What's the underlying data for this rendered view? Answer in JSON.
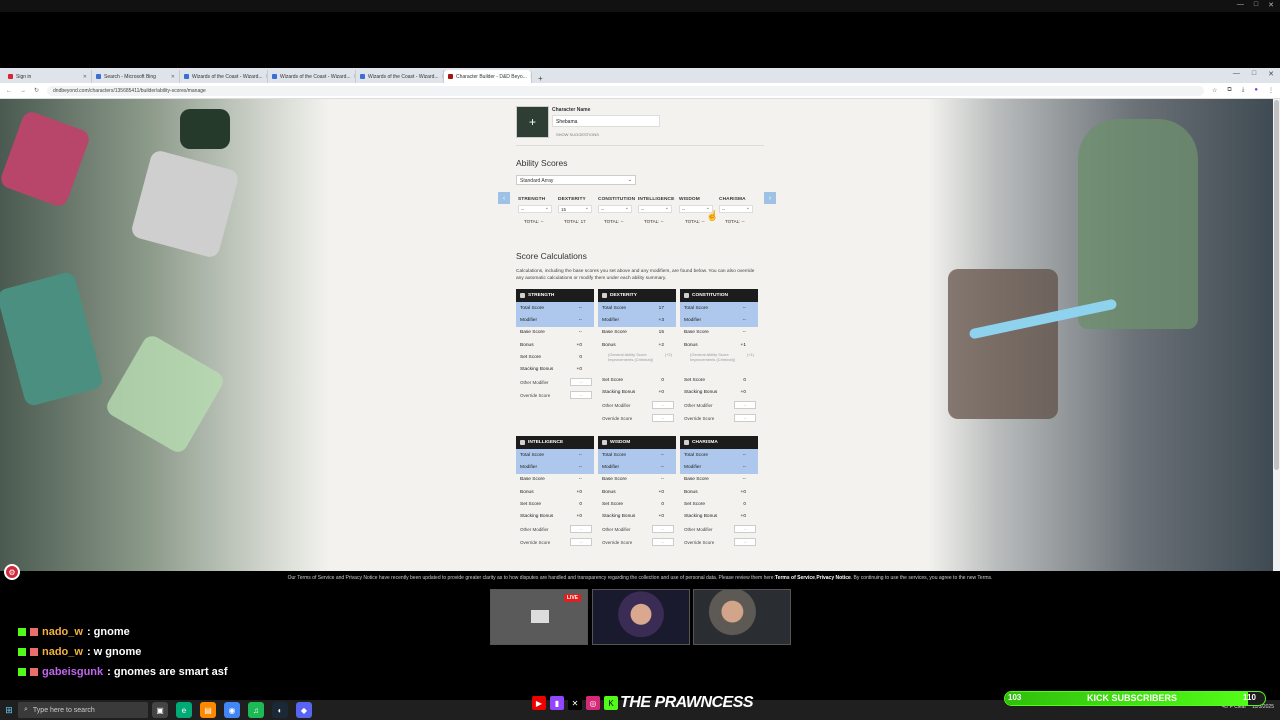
{
  "window": {
    "controls": [
      "—",
      "□",
      "✕"
    ]
  },
  "browser": {
    "tabs": [
      {
        "label": "Sign in",
        "active": false
      },
      {
        "label": "Search - Microsoft Bing",
        "active": false
      },
      {
        "label": "Wizards of the Coast - Wizard...",
        "active": false
      },
      {
        "label": "Wizards of the Coast - Wizard...",
        "active": false
      },
      {
        "label": "Wizards of the Coast - Wizard...",
        "active": false
      },
      {
        "label": "Character Builder - D&D Beyo...",
        "active": true
      }
    ],
    "url": "dndbeyond.com/characters/135685411/builder/ability-scores/manage"
  },
  "character": {
    "name_label": "Character Name",
    "name_value": "Shebama",
    "suggestions": "SHOW SUGGESTIONS"
  },
  "ability_scores": {
    "title": "Ability Scores",
    "method": "Standard Array",
    "columns": [
      {
        "name": "STRENGTH",
        "selected": "--",
        "total": "TOTAL: --"
      },
      {
        "name": "DEXTERITY",
        "selected": "15",
        "total": "TOTAL: 17"
      },
      {
        "name": "CONSTITUTION",
        "selected": "--",
        "total": "TOTAL: --"
      },
      {
        "name": "INTELLIGENCE",
        "selected": "--",
        "total": "TOTAL: --"
      },
      {
        "name": "WISDOM",
        "selected": "--",
        "total": "TOTAL: --"
      },
      {
        "name": "CHARISMA",
        "selected": "--",
        "total": "TOTAL: --"
      }
    ]
  },
  "score_calculations": {
    "title": "Score Calculations",
    "description": "Calculations, including the base scores you set above and any modifiers, are found below. You can also override any automatic calculations or modify them under each ability summary.",
    "labels": {
      "total": "Total Score",
      "modifier": "Modifier",
      "base": "Base Score",
      "bonus": "Bonus",
      "set": "Set Score",
      "stacking": "Stacking Bonus",
      "other": "Other Modifier",
      "override": "Override Score",
      "note": "(General Ability Score Improvements (Criminal))"
    },
    "cards": [
      {
        "name": "STRENGTH",
        "total": "--",
        "modifier": "--",
        "base": "--",
        "bonus": "+0",
        "set": "0",
        "stacking": "+0",
        "note_value": "",
        "has_note": false,
        "other": "--",
        "override": "--"
      },
      {
        "name": "DEXTERITY",
        "total": "17",
        "modifier": "+3",
        "base": "15",
        "bonus": "+2",
        "set": "0",
        "stacking": "+0",
        "note_value": "(+2)",
        "has_note": true,
        "other": "--",
        "override": "--"
      },
      {
        "name": "CONSTITUTION",
        "total": "--",
        "modifier": "--",
        "base": "--",
        "bonus": "+1",
        "set": "0",
        "stacking": "+0",
        "note_value": "(+1)",
        "has_note": true,
        "other": "--",
        "override": "--"
      },
      {
        "name": "INTELLIGENCE",
        "total": "--",
        "modifier": "--",
        "base": "--",
        "bonus": "+0",
        "set": "0",
        "stacking": "+0",
        "note_value": "",
        "has_note": false,
        "other": "--",
        "override": "--"
      },
      {
        "name": "WISDOM",
        "total": "--",
        "modifier": "--",
        "base": "--",
        "bonus": "+0",
        "set": "0",
        "stacking": "+0",
        "note_value": "",
        "has_note": false,
        "other": "--",
        "override": "--"
      },
      {
        "name": "CHARISMA",
        "total": "--",
        "modifier": "--",
        "base": "--",
        "bonus": "+0",
        "set": "0",
        "stacking": "+0",
        "note_value": "",
        "has_note": false,
        "other": "--",
        "override": "--"
      }
    ]
  },
  "terms": {
    "text": "Our Terms of Service and Privacy Notice have recently been updated to provide greater clarity as to how disputes are handled and transparency regarding the collection and use of personal data. Please review them here: ",
    "link1": "Terms of Service",
    "sep": ", ",
    "link2": "Privacy Notice",
    "tail": ". By continuing to use the services, you agree to the new Terms."
  },
  "stream": {
    "live": "LIVE",
    "chat": [
      {
        "user": "nado_w",
        "msg": ": gnome",
        "color": "u1"
      },
      {
        "user": "nado_w",
        "msg": ": w gnome",
        "color": "u1"
      },
      {
        "user": "gabeisgunk",
        "msg": ": gnomes are smart asf",
        "color": "u2"
      }
    ],
    "brand": "THE PRAWNCESS",
    "kick": {
      "label": "KICK SUBSCRIBERS",
      "current": "103",
      "goal": "110",
      "fraction": 0.936
    }
  },
  "taskbar": {
    "search_placeholder": "Type here to search",
    "weather": "45°F Clear",
    "time": "11/3/2025"
  },
  "colors": {
    "highlight": "#adc8ec",
    "kick": "#53fc18",
    "header": "#1c1c1c"
  }
}
